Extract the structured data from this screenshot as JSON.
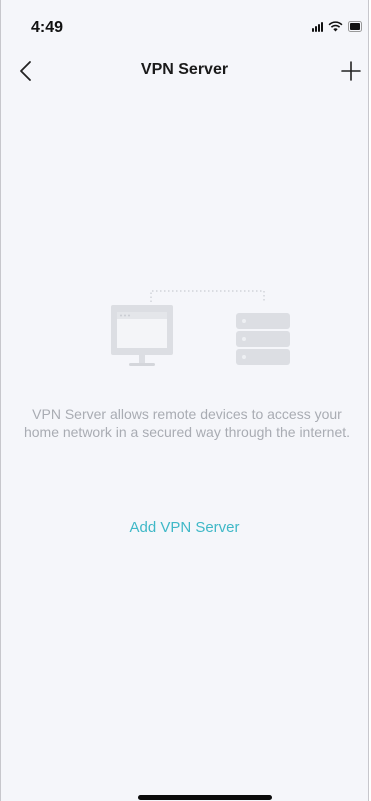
{
  "status_bar": {
    "time": "4:49",
    "icons": [
      "signal-icon",
      "wifi-icon",
      "battery-icon"
    ]
  },
  "nav": {
    "title": "VPN Server",
    "back_icon": "chevron-left-icon",
    "add_icon": "plus-icon"
  },
  "empty_state": {
    "illustration": [
      "monitor-icon",
      "server-rack-icon"
    ],
    "description": "VPN Server allows remote devices to access your home network in a secured way through the internet.",
    "action_label": "Add VPN Server"
  },
  "colors": {
    "background": "#f5f6fa",
    "accent": "#3fb8c7",
    "muted_text": "#a9acb3"
  }
}
